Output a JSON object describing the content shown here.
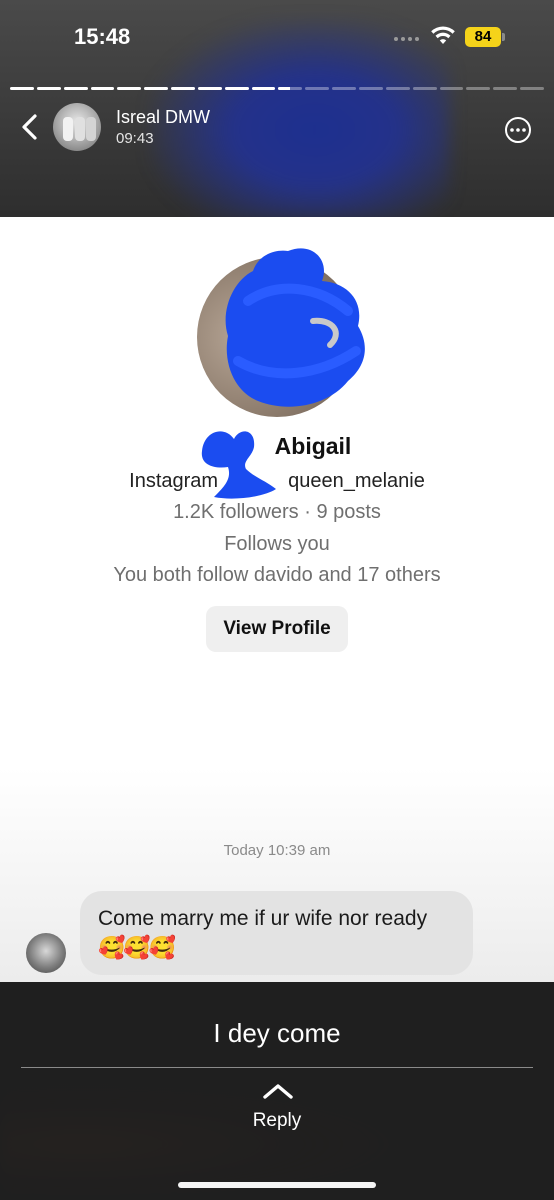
{
  "status_bar": {
    "time": "15:48",
    "battery": "84"
  },
  "story": {
    "segments": [
      1,
      1,
      1,
      1,
      1,
      1,
      1,
      1,
      1,
      1,
      0.5,
      0,
      0,
      0,
      0,
      0,
      0,
      0,
      0,
      0
    ],
    "user_name": "Isreal DMW",
    "posted_time": "09:43"
  },
  "profile": {
    "name": "Abigail",
    "handle_prefix": "Instagram",
    "handle_suffix": "queen_melanie",
    "stats": "1.2K followers · 9 posts",
    "follows_you": "Follows you",
    "mutuals": "You both follow davido and 17 others",
    "view_profile_label": "View Profile"
  },
  "message": {
    "timestamp": "Today 10:39 am",
    "text": "Come marry me if ur wife nor ready",
    "emojis": "🥰🥰🥰"
  },
  "reply": {
    "caption": "I dey come",
    "label": "Reply"
  },
  "colors": {
    "battery": "#f5d31a",
    "scribble": "#1b4cf0"
  }
}
